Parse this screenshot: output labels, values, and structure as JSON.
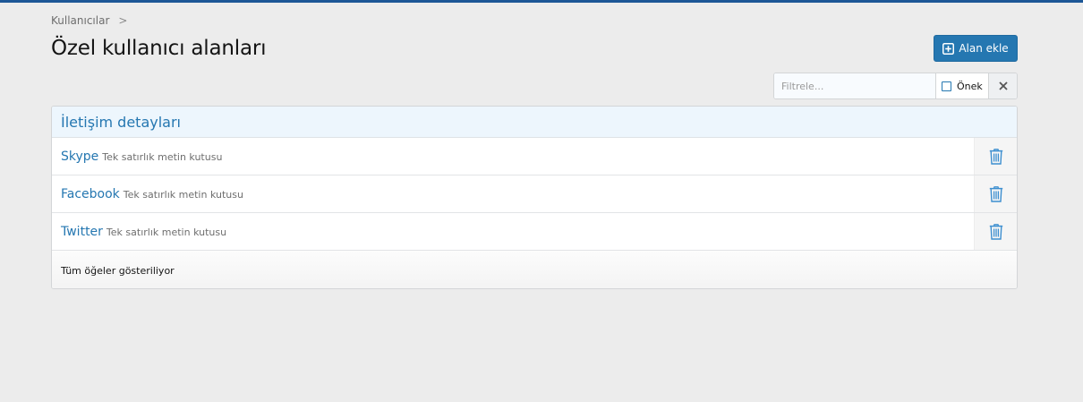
{
  "breadcrumb": {
    "items": [
      "Kullanıcılar"
    ],
    "separator": ">"
  },
  "page": {
    "title": "Özel kullanıcı alanları"
  },
  "actions": {
    "add_label": "Alan ekle",
    "add_icon": "plus-square-icon"
  },
  "filter": {
    "placeholder": "Filtrele...",
    "value": "",
    "prefix_label": "Önek",
    "prefix_checked": false,
    "clear_icon": "close-icon"
  },
  "group": {
    "title": "İletişim detayları",
    "rows": [
      {
        "title": "Skype",
        "hint": "Tek satırlık metin kutusu",
        "delete_icon": "trash-icon"
      },
      {
        "title": "Facebook",
        "hint": "Tek satırlık metin kutusu",
        "delete_icon": "trash-icon"
      },
      {
        "title": "Twitter",
        "hint": "Tek satırlık metin kutusu",
        "delete_icon": "trash-icon"
      }
    ],
    "footer": "Tüm öğeler gösteriliyor"
  },
  "colors": {
    "accent": "#2577b1",
    "top_bar": "#1d5796",
    "background": "#ececec",
    "header_bg": "#edf6fd"
  }
}
